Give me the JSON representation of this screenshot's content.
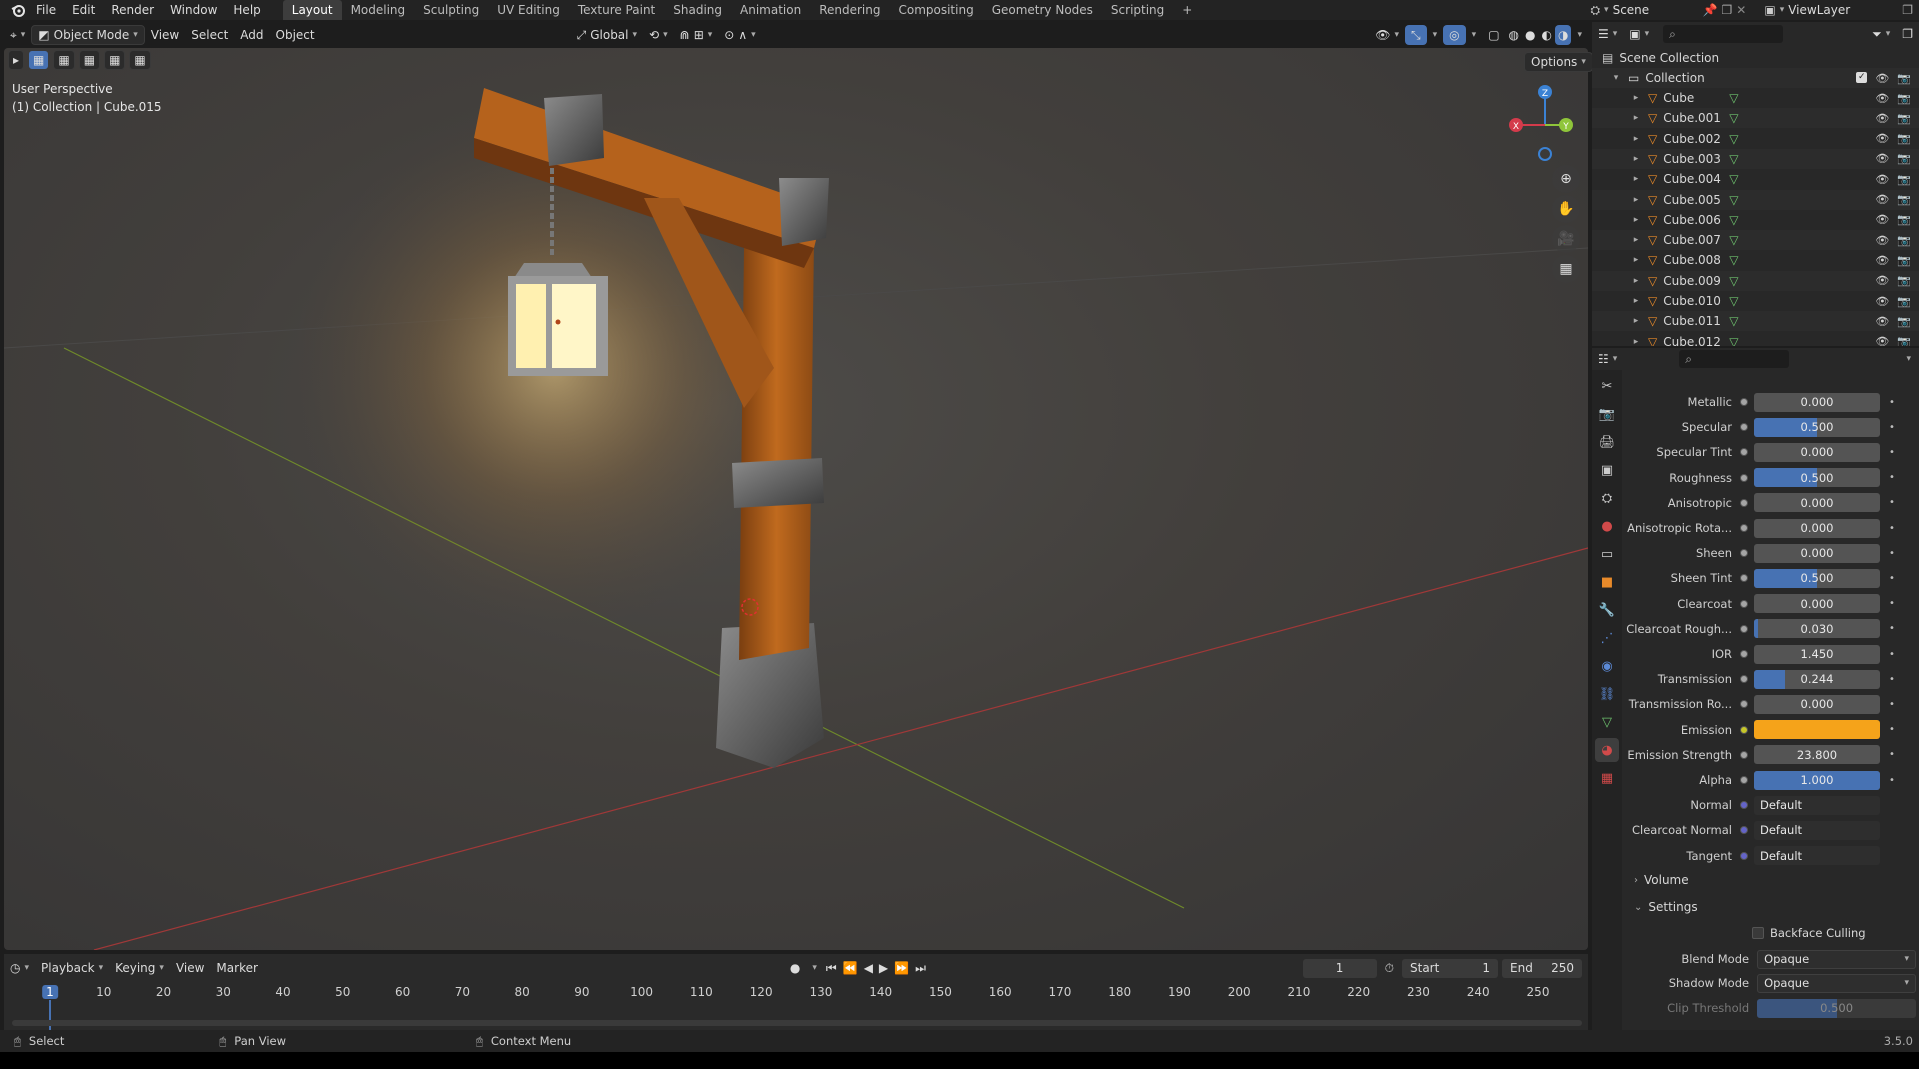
{
  "menu": [
    "File",
    "Edit",
    "Render",
    "Window",
    "Help"
  ],
  "workspaces": [
    "Layout",
    "Modeling",
    "Sculpting",
    "UV Editing",
    "Texture Paint",
    "Shading",
    "Animation",
    "Rendering",
    "Compositing",
    "Geometry Nodes",
    "Scripting"
  ],
  "active_workspace": "Layout",
  "add_tab": "+",
  "scene": "Scene",
  "view_layer": "ViewLayer",
  "viewport_header": {
    "mode": "Object Mode",
    "menus": [
      "View",
      "Select",
      "Add",
      "Object"
    ],
    "orientation": "Global",
    "options": "Options"
  },
  "viewport": {
    "perspective": "User Perspective",
    "collection_info": "(1) Collection | Cube.015"
  },
  "gizmo": {
    "z": "Z",
    "x": "X",
    "y": "Y"
  },
  "outliner": {
    "scene_collection": "Scene Collection",
    "collection": "Collection",
    "objects": [
      "Cube",
      "Cube.001",
      "Cube.002",
      "Cube.003",
      "Cube.004",
      "Cube.005",
      "Cube.006",
      "Cube.007",
      "Cube.008",
      "Cube.009",
      "Cube.010",
      "Cube.011",
      "Cube.012"
    ]
  },
  "properties": {
    "rows": [
      {
        "label": "Metallic",
        "value": "0.000",
        "fill": 0,
        "dot": "grey"
      },
      {
        "label": "Specular",
        "value": "0.500",
        "fill": 0.5,
        "dot": "grey"
      },
      {
        "label": "Specular Tint",
        "value": "0.000",
        "fill": 0,
        "dot": "grey"
      },
      {
        "label": "Roughness",
        "value": "0.500",
        "fill": 0.5,
        "dot": "grey"
      },
      {
        "label": "Anisotropic",
        "value": "0.000",
        "fill": 0,
        "dot": "grey"
      },
      {
        "label": "Anisotropic Rota...",
        "value": "0.000",
        "fill": 0,
        "dot": "grey"
      },
      {
        "label": "Sheen",
        "value": "0.000",
        "fill": 0,
        "dot": "grey"
      },
      {
        "label": "Sheen Tint",
        "value": "0.500",
        "fill": 0.5,
        "dot": "grey"
      },
      {
        "label": "Clearcoat",
        "value": "0.000",
        "fill": 0,
        "dot": "grey"
      },
      {
        "label": "Clearcoat Rough...",
        "value": "0.030",
        "fill": 0.03,
        "dot": "grey"
      },
      {
        "label": "IOR",
        "value": "1.450",
        "fill": 0,
        "dot": "grey"
      },
      {
        "label": "Transmission",
        "value": "0.244",
        "fill": 0.244,
        "dot": "grey"
      },
      {
        "label": "Transmission Ro...",
        "value": "0.000",
        "fill": 0,
        "dot": "grey"
      },
      {
        "label": "Emission",
        "value": "",
        "color": "#f5a31a",
        "dot": "yellow"
      },
      {
        "label": "Emission Strength",
        "value": "23.800",
        "fill": 0,
        "dot": "grey"
      },
      {
        "label": "Alpha",
        "value": "1.000",
        "fill": 1,
        "dot": "grey"
      },
      {
        "label": "Normal",
        "value": "Default",
        "text": true,
        "dot": "purple"
      },
      {
        "label": "Clearcoat Normal",
        "value": "Default",
        "text": true,
        "dot": "purple"
      },
      {
        "label": "Tangent",
        "value": "Default",
        "text": true,
        "dot": "purple"
      }
    ],
    "volume": "Volume",
    "settings": "Settings",
    "backface_culling": "Backface Culling",
    "blend_mode_label": "Blend Mode",
    "blend_mode": "Opaque",
    "shadow_mode_label": "Shadow Mode",
    "shadow_mode": "Opaque",
    "clip_threshold_label": "Clip Threshold",
    "clip_threshold": "0.500"
  },
  "timeline": {
    "menus": [
      "Playback",
      "Keying",
      "View",
      "Marker"
    ],
    "current_frame": "1",
    "start_label": "Start",
    "start": "1",
    "end_label": "End",
    "end": "250",
    "ticks": [
      "1",
      "10",
      "20",
      "30",
      "40",
      "50",
      "60",
      "70",
      "80",
      "90",
      "100",
      "110",
      "120",
      "130",
      "140",
      "150",
      "160",
      "170",
      "180",
      "190",
      "200",
      "210",
      "220",
      "230",
      "240",
      "250"
    ]
  },
  "status": {
    "select": "Select",
    "pan": "Pan View",
    "context": "Context Menu",
    "version": "3.5.0"
  },
  "colors": {
    "accent": "#4772b3",
    "emission": "#f5a31a",
    "axis_x": "#d43b4b",
    "axis_y": "#8fc53a",
    "axis_z": "#3b82d4"
  }
}
